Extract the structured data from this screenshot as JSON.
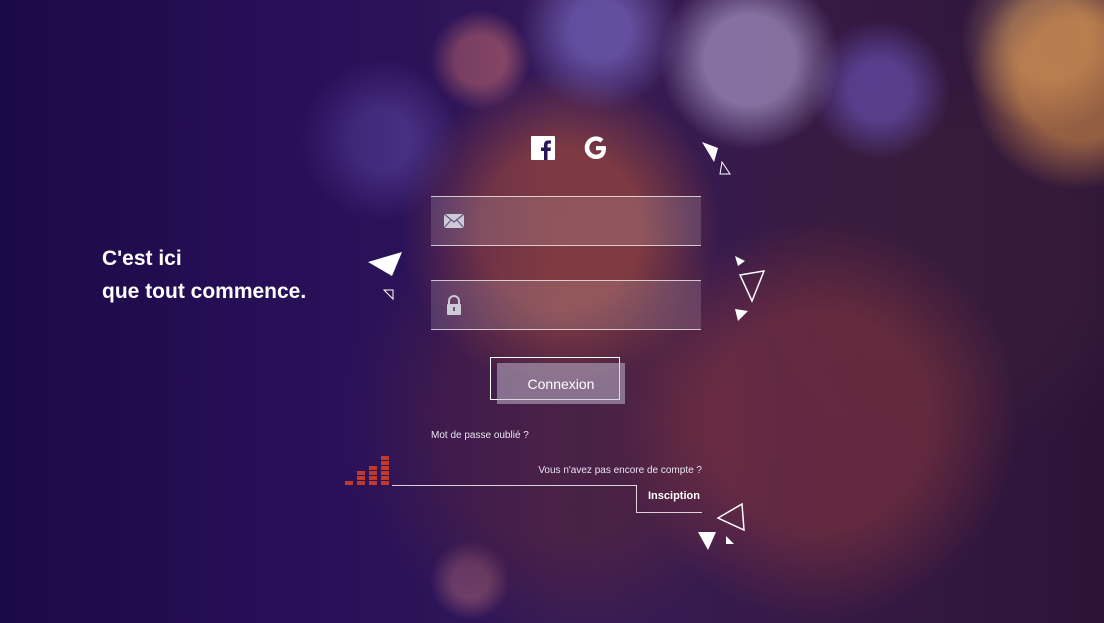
{
  "tagline": {
    "line1": "C'est ici",
    "line2": "que tout commence."
  },
  "social": {
    "facebook_icon": "facebook-icon",
    "google_icon": "google-icon"
  },
  "form": {
    "email": {
      "icon": "envelope-icon",
      "value": "",
      "placeholder": ""
    },
    "password": {
      "icon": "lock-icon",
      "value": "",
      "placeholder": ""
    },
    "submit_label": "Connexion",
    "forgot_label": "Mot de passe oublié ?"
  },
  "signup": {
    "prompt": "Vous n'avez pas encore de compte ?",
    "link_label": "Insciption"
  },
  "colors": {
    "accent_red": "#c0392b",
    "background": "#1c0b45"
  }
}
